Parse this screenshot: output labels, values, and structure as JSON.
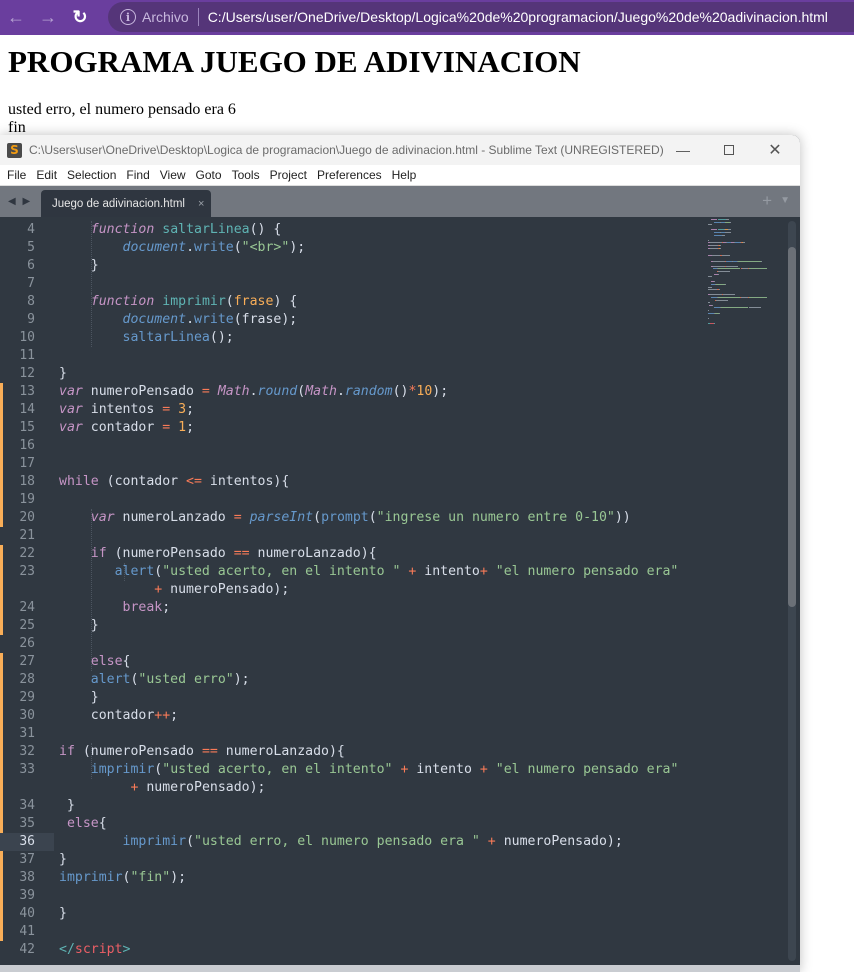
{
  "browser": {
    "back_icon": "arrow-left-icon",
    "forward_icon": "arrow-right-icon",
    "reload_icon": "reload-icon",
    "info_icon": "info-icon",
    "scheme_label": "Archivo",
    "url": "C:/Users/user/OneDrive/Desktop/Logica%20de%20programacion/Juego%20de%20adivinacion.html",
    "accent_color": "#6a3e9e"
  },
  "page": {
    "heading": "PROGRAMA JUEGO DE ADIVINACION",
    "lines": [
      "usted erro, el numero pensado era 6",
      "fin"
    ]
  },
  "sublime": {
    "title": "C:\\Users\\user\\OneDrive\\Desktop\\Logica de programacion\\Juego de adivinacion.html - Sublime Text (UNREGISTERED)",
    "logo_glyph": "S",
    "window_controls": {
      "minimize": "—",
      "maximize": "",
      "close": "✕"
    },
    "menu": [
      "File",
      "Edit",
      "Selection",
      "Find",
      "View",
      "Goto",
      "Tools",
      "Project",
      "Preferences",
      "Help"
    ],
    "tab_nav": "◀ ▶",
    "tabs": [
      {
        "label": "Juego de adivinacion.html",
        "close": "×",
        "active": true
      }
    ],
    "tab_plus": "+",
    "tab_menu": "▼",
    "active_line": 36,
    "modified_lines": [
      13,
      14,
      15,
      16,
      17,
      18,
      19,
      20,
      22,
      23,
      24,
      25,
      27,
      28,
      29,
      30,
      31,
      32,
      33,
      34,
      35,
      36,
      37,
      38,
      39,
      40,
      41
    ],
    "code": [
      {
        "n": "4",
        "tokens": [
          [
            "",
            "    "
          ],
          [
            "kwi",
            "function"
          ],
          [
            "",
            " "
          ],
          [
            "fn",
            "saltarLinea"
          ],
          [
            "",
            "() {"
          ]
        ]
      },
      {
        "n": "5",
        "tokens": [
          [
            "",
            "        "
          ],
          [
            "obj",
            "document"
          ],
          [
            "",
            "."
          ],
          [
            "call",
            "write"
          ],
          [
            "",
            "("
          ],
          [
            "str",
            "\"<br>\""
          ],
          [
            "",
            ");"
          ]
        ]
      },
      {
        "n": "6",
        "tokens": [
          [
            "",
            "    }"
          ]
        ]
      },
      {
        "n": "7",
        "tokens": []
      },
      {
        "n": "8",
        "tokens": [
          [
            "",
            "    "
          ],
          [
            "kwi",
            "function"
          ],
          [
            "",
            " "
          ],
          [
            "fn",
            "imprimir"
          ],
          [
            "",
            "("
          ],
          [
            "param",
            "frase"
          ],
          [
            "",
            ") {"
          ]
        ]
      },
      {
        "n": "9",
        "tokens": [
          [
            "",
            "        "
          ],
          [
            "obj",
            "document"
          ],
          [
            "",
            "."
          ],
          [
            "call",
            "write"
          ],
          [
            "",
            "(frase);"
          ]
        ]
      },
      {
        "n": "10",
        "tokens": [
          [
            "",
            "        "
          ],
          [
            "call",
            "saltarLinea"
          ],
          [
            "",
            "();"
          ]
        ]
      },
      {
        "n": "11",
        "tokens": []
      },
      {
        "n": "12",
        "tokens": [
          [
            "",
            "}"
          ]
        ]
      },
      {
        "n": "13",
        "tokens": [
          [
            "kwi",
            "var"
          ],
          [
            "",
            " numeroPensado "
          ],
          [
            "op",
            "="
          ],
          [
            "",
            " "
          ],
          [
            "math",
            "Math"
          ],
          [
            "",
            "."
          ],
          [
            "calli",
            "round"
          ],
          [
            "",
            "("
          ],
          [
            "math",
            "Math"
          ],
          [
            "",
            "."
          ],
          [
            "calli",
            "random"
          ],
          [
            "",
            "()"
          ],
          [
            "op",
            "*"
          ],
          [
            "num",
            "10"
          ],
          [
            "",
            ");"
          ]
        ]
      },
      {
        "n": "14",
        "tokens": [
          [
            "kwi",
            "var"
          ],
          [
            "",
            " intentos "
          ],
          [
            "op",
            "="
          ],
          [
            "",
            " "
          ],
          [
            "num",
            "3"
          ],
          [
            "",
            ";"
          ]
        ]
      },
      {
        "n": "15",
        "tokens": [
          [
            "kwi",
            "var"
          ],
          [
            "",
            " contador "
          ],
          [
            "op",
            "="
          ],
          [
            "",
            " "
          ],
          [
            "num",
            "1"
          ],
          [
            "",
            ";"
          ]
        ]
      },
      {
        "n": "16",
        "tokens": []
      },
      {
        "n": "17",
        "tokens": []
      },
      {
        "n": "18",
        "tokens": [
          [
            "kw",
            "while"
          ],
          [
            "",
            " (contador "
          ],
          [
            "op",
            "<="
          ],
          [
            "",
            " intentos){"
          ]
        ]
      },
      {
        "n": "19",
        "tokens": []
      },
      {
        "n": "20",
        "tokens": [
          [
            "",
            "    "
          ],
          [
            "kwi",
            "var"
          ],
          [
            "",
            " numeroLanzado "
          ],
          [
            "op",
            "="
          ],
          [
            "",
            " "
          ],
          [
            "calli",
            "parseInt"
          ],
          [
            "",
            "("
          ],
          [
            "call",
            "prompt"
          ],
          [
            "",
            "("
          ],
          [
            "str",
            "\"ingrese un numero entre 0-10\""
          ],
          [
            "",
            "))"
          ]
        ]
      },
      {
        "n": "21",
        "tokens": []
      },
      {
        "n": "22",
        "tokens": [
          [
            "",
            "    "
          ],
          [
            "kw",
            "if"
          ],
          [
            "",
            " (numeroPensado "
          ],
          [
            "op",
            "=="
          ],
          [
            "",
            " numeroLanzado){"
          ]
        ]
      },
      {
        "n": "23",
        "tokens": [
          [
            "",
            "       "
          ],
          [
            "call",
            "alert"
          ],
          [
            "",
            "("
          ],
          [
            "str",
            "\"usted acerto, en el intento \""
          ],
          [
            "",
            " "
          ],
          [
            "op",
            "+"
          ],
          [
            "",
            " intento"
          ],
          [
            "op",
            "+"
          ],
          [
            "",
            " "
          ],
          [
            "str",
            "\"el numero pensado era\""
          ]
        ]
      },
      {
        "n": "",
        "tokens": [
          [
            "",
            "            "
          ],
          [
            "op",
            "+"
          ],
          [
            "",
            " numeroPensado);"
          ]
        ]
      },
      {
        "n": "24",
        "tokens": [
          [
            "",
            "        "
          ],
          [
            "kw",
            "break"
          ],
          [
            "",
            ";"
          ]
        ]
      },
      {
        "n": "25",
        "tokens": [
          [
            "",
            "    }"
          ]
        ]
      },
      {
        "n": "26",
        "tokens": []
      },
      {
        "n": "27",
        "tokens": [
          [
            "",
            "    "
          ],
          [
            "kw",
            "else"
          ],
          [
            "",
            "{"
          ]
        ]
      },
      {
        "n": "28",
        "tokens": [
          [
            "",
            "    "
          ],
          [
            "call",
            "alert"
          ],
          [
            "",
            "("
          ],
          [
            "str",
            "\"usted erro\""
          ],
          [
            "",
            ");"
          ]
        ]
      },
      {
        "n": "29",
        "tokens": [
          [
            "",
            "    }"
          ]
        ]
      },
      {
        "n": "30",
        "tokens": [
          [
            "",
            "    contador"
          ],
          [
            "op",
            "++"
          ],
          [
            "",
            ";"
          ]
        ]
      },
      {
        "n": "31",
        "tokens": []
      },
      {
        "n": "32",
        "tokens": [
          [
            "kw",
            "if"
          ],
          [
            "",
            " (numeroPensado "
          ],
          [
            "op",
            "=="
          ],
          [
            "",
            " numeroLanzado){"
          ]
        ]
      },
      {
        "n": "33",
        "tokens": [
          [
            "",
            "    "
          ],
          [
            "call",
            "imprimir"
          ],
          [
            "",
            "("
          ],
          [
            "str",
            "\"usted acerto, en el intento\""
          ],
          [
            "",
            " "
          ],
          [
            "op",
            "+"
          ],
          [
            "",
            " intento "
          ],
          [
            "op",
            "+"
          ],
          [
            "",
            " "
          ],
          [
            "str",
            "\"el numero pensado era\""
          ]
        ]
      },
      {
        "n": "",
        "tokens": [
          [
            "",
            "         "
          ],
          [
            "op",
            "+"
          ],
          [
            "",
            " numeroPensado);"
          ]
        ]
      },
      {
        "n": "34",
        "tokens": [
          [
            "",
            " }"
          ]
        ]
      },
      {
        "n": "35",
        "tokens": [
          [
            "",
            " "
          ],
          [
            "kw",
            "else"
          ],
          [
            "",
            "{"
          ]
        ]
      },
      {
        "n": "36",
        "tokens": [
          [
            "",
            "        "
          ],
          [
            "call",
            "imprimir"
          ],
          [
            "",
            "("
          ],
          [
            "str",
            "\"usted erro, el numero pensado era \""
          ],
          [
            "",
            " "
          ],
          [
            "op",
            "+"
          ],
          [
            "",
            " numeroPensado);"
          ]
        ]
      },
      {
        "n": "37",
        "tokens": [
          [
            "",
            "}"
          ]
        ]
      },
      {
        "n": "38",
        "tokens": [
          [
            "call",
            "imprimir"
          ],
          [
            "",
            "("
          ],
          [
            "str",
            "\"fin\""
          ],
          [
            "",
            ");"
          ]
        ]
      },
      {
        "n": "39",
        "tokens": []
      },
      {
        "n": "40",
        "tokens": [
          [
            "",
            "}"
          ]
        ]
      },
      {
        "n": "41",
        "tokens": []
      },
      {
        "n": "42",
        "tokens": [
          [
            "tag",
            "</"
          ],
          [
            "tagname",
            "script"
          ],
          [
            "tag",
            ">"
          ]
        ]
      }
    ]
  }
}
